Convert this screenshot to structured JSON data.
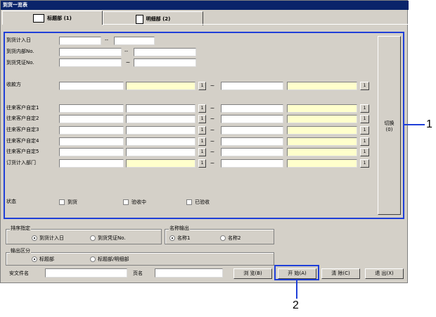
{
  "window": {
    "title": "到货一览表"
  },
  "tabs": [
    {
      "label": "标题部 (1)",
      "icon": "book-icon"
    },
    {
      "label": "明细部 (2)",
      "icon": "document-icon"
    }
  ],
  "form": {
    "arrival_date_label": "到货计入日",
    "arrival_internal_no_label": "到货内部No.",
    "arrival_voucher_no_label": "到货凭证No.",
    "payee_label": "收款方",
    "custom_labels": [
      "往来客户自定1",
      "往来客户自定2",
      "往来客户自定3",
      "往来客户自定4",
      "往来客户自定5"
    ],
    "order_dept_label": "订货计入部门",
    "range_sep": "~",
    "dash_sep": "--",
    "lookup_btn": "1",
    "status_label": "状态",
    "status_options": [
      "到货",
      "验收中",
      "已验收"
    ],
    "switch_label": "切换",
    "switch_key": "(0)"
  },
  "sort": {
    "title": "排序指定",
    "options": [
      "到货计入日",
      "到货凭证No."
    ],
    "selected": 0
  },
  "name_output": {
    "title": "名称输出",
    "options": [
      "名称1",
      "名称2"
    ],
    "selected": 0
  },
  "output_section": {
    "title": "输出区分",
    "options": [
      "标题部",
      "标题部/明细部"
    ],
    "selected": 0
  },
  "footer": {
    "file_label": "安文件名",
    "sheet_label": "页名",
    "browse_btn": "浏 览(B)",
    "start_btn": "开 始(A)",
    "clear_btn": "清 除(C)",
    "exit_btn": "退 出(X)"
  },
  "callouts": [
    "1",
    "2"
  ],
  "colors": {
    "highlight": "#1f3fd8",
    "field_yellow": "#ffffcc",
    "title_bar": "#0a246a"
  }
}
